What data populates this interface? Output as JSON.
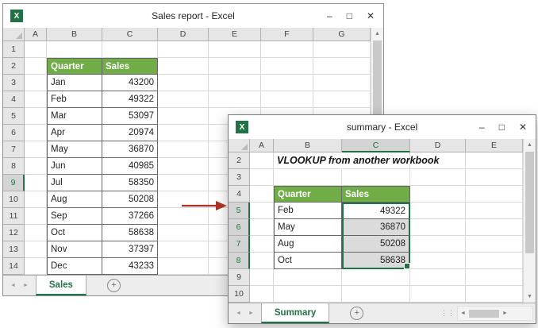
{
  "colors": {
    "excel_green": "#217346",
    "table_header_green": "#70AD47",
    "arrow_red": "#A93226"
  },
  "glyphs": {
    "excel_icon_letter": "X",
    "minimize": "–",
    "maximize": "□",
    "close": "✕",
    "up": "▲",
    "down": "▼",
    "left": "◄",
    "right": "►",
    "nav_left": "◄",
    "nav_right": "►",
    "new_sheet": "+",
    "grip": "⋮⋮"
  },
  "window1": {
    "title": "Sales report - Excel",
    "tab": "Sales",
    "columns": [
      "A",
      "B",
      "C",
      "D",
      "E",
      "F",
      "G"
    ],
    "rows": [
      "1",
      "2",
      "3",
      "4",
      "5",
      "6",
      "7",
      "8",
      "9",
      "10",
      "11",
      "12",
      "13",
      "14"
    ],
    "selected_row_headers": [
      "9"
    ],
    "cells": [
      {
        "c": "B",
        "r": "2",
        "t": "Quarter",
        "k": "th"
      },
      {
        "c": "C",
        "r": "2",
        "t": "Sales",
        "k": "th"
      },
      {
        "c": "B",
        "r": "3",
        "t": "Jan",
        "k": "lbl"
      },
      {
        "c": "C",
        "r": "3",
        "t": "43200",
        "k": "num"
      },
      {
        "c": "B",
        "r": "4",
        "t": "Feb",
        "k": "lbl"
      },
      {
        "c": "C",
        "r": "4",
        "t": "49322",
        "k": "num"
      },
      {
        "c": "B",
        "r": "5",
        "t": "Mar",
        "k": "lbl"
      },
      {
        "c": "C",
        "r": "5",
        "t": "53097",
        "k": "num"
      },
      {
        "c": "B",
        "r": "6",
        "t": "Apr",
        "k": "lbl"
      },
      {
        "c": "C",
        "r": "6",
        "t": "20974",
        "k": "num"
      },
      {
        "c": "B",
        "r": "7",
        "t": "May",
        "k": "lbl"
      },
      {
        "c": "C",
        "r": "7",
        "t": "36870",
        "k": "num"
      },
      {
        "c": "B",
        "r": "8",
        "t": "Jun",
        "k": "lbl"
      },
      {
        "c": "C",
        "r": "8",
        "t": "40985",
        "k": "num"
      },
      {
        "c": "B",
        "r": "9",
        "t": "Jul",
        "k": "lbl"
      },
      {
        "c": "C",
        "r": "9",
        "t": "58350",
        "k": "num"
      },
      {
        "c": "B",
        "r": "10",
        "t": "Aug",
        "k": "lbl"
      },
      {
        "c": "C",
        "r": "10",
        "t": "50208",
        "k": "num"
      },
      {
        "c": "B",
        "r": "11",
        "t": "Sep",
        "k": "lbl"
      },
      {
        "c": "C",
        "r": "11",
        "t": "37266",
        "k": "num"
      },
      {
        "c": "B",
        "r": "12",
        "t": "Oct",
        "k": "lbl"
      },
      {
        "c": "C",
        "r": "12",
        "t": "58638",
        "k": "num"
      },
      {
        "c": "B",
        "r": "13",
        "t": "Nov",
        "k": "lbl"
      },
      {
        "c": "C",
        "r": "13",
        "t": "37397",
        "k": "num"
      },
      {
        "c": "B",
        "r": "14",
        "t": "Dec",
        "k": "lbl"
      },
      {
        "c": "C",
        "r": "14",
        "t": "43233",
        "k": "num"
      }
    ]
  },
  "window2": {
    "title": "summary - Excel",
    "tab": "Summary",
    "columns": [
      "A",
      "B",
      "C",
      "D",
      "E"
    ],
    "rows": [
      "2",
      "3",
      "4",
      "5",
      "6",
      "7",
      "8",
      "9",
      "10"
    ],
    "selection": {
      "col": "C",
      "rows": [
        "5",
        "6",
        "7",
        "8"
      ],
      "active": "5"
    },
    "cells": [
      {
        "c": "B",
        "r": "2",
        "t": "VLOOKUP from another workbook",
        "k": "heading"
      },
      {
        "c": "B",
        "r": "4",
        "t": "Quarter",
        "k": "th"
      },
      {
        "c": "C",
        "r": "4",
        "t": "Sales",
        "k": "th"
      },
      {
        "c": "B",
        "r": "5",
        "t": "Feb",
        "k": "lbl"
      },
      {
        "c": "C",
        "r": "5",
        "t": "49322",
        "k": "num"
      },
      {
        "c": "B",
        "r": "6",
        "t": "May",
        "k": "lbl"
      },
      {
        "c": "C",
        "r": "6",
        "t": "36870",
        "k": "num"
      },
      {
        "c": "B",
        "r": "7",
        "t": "Aug",
        "k": "lbl"
      },
      {
        "c": "C",
        "r": "7",
        "t": "50208",
        "k": "num"
      },
      {
        "c": "B",
        "r": "8",
        "t": "Oct",
        "k": "lbl"
      },
      {
        "c": "C",
        "r": "8",
        "t": "58638",
        "k": "num"
      }
    ]
  }
}
